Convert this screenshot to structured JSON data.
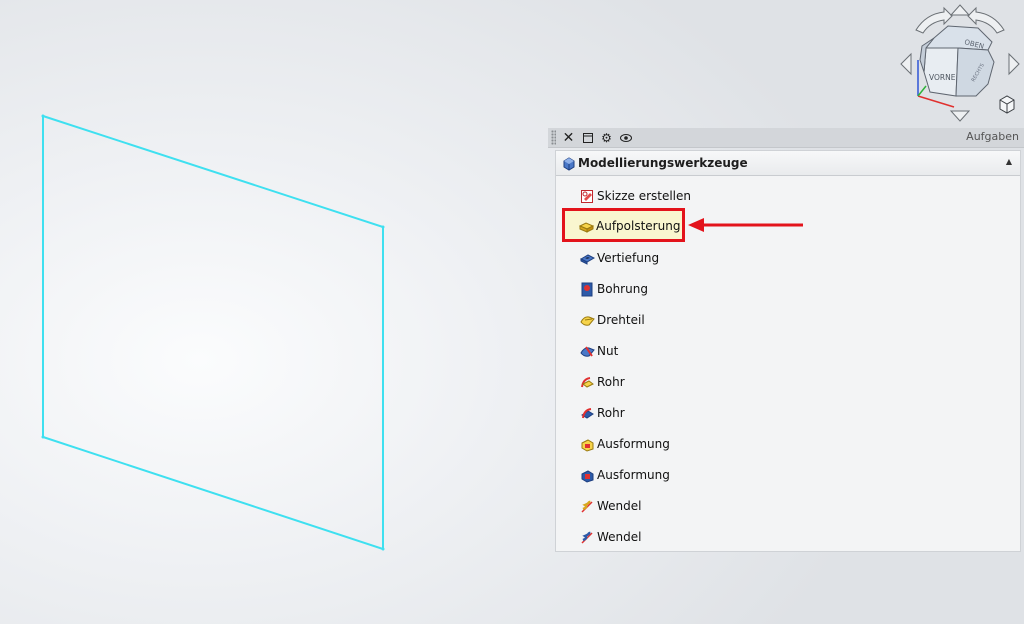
{
  "task_panel": {
    "title": "Aufgaben",
    "toolbar": {
      "close_icon": "close-icon",
      "float_icon": "dock-float-icon",
      "settings_icon": "gear-icon",
      "visibility_icon": "eye-icon"
    },
    "group": {
      "title": "Modellierungswerkzeuge",
      "icon": "part-design-icon",
      "collapse_icon": "chevron-up-icon"
    },
    "items": [
      {
        "label": "Skizze erstellen",
        "icon": "new-sketch-icon"
      },
      {
        "label": "Aufpolsterung",
        "icon": "pad-icon"
      },
      {
        "label": "Vertiefung",
        "icon": "pocket-icon"
      },
      {
        "label": "Bohrung",
        "icon": "hole-icon"
      },
      {
        "label": "Drehteil",
        "icon": "revolution-icon"
      },
      {
        "label": "Nut",
        "icon": "groove-icon"
      },
      {
        "label": "Rohr",
        "icon": "additive-pipe-icon"
      },
      {
        "label": "Rohr",
        "icon": "subtractive-pipe-icon"
      },
      {
        "label": "Ausformung",
        "icon": "additive-loft-icon"
      },
      {
        "label": "Ausformung",
        "icon": "subtractive-loft-icon"
      },
      {
        "label": "Wendel",
        "icon": "additive-helix-icon"
      },
      {
        "label": "Wendel",
        "icon": "subtractive-helix-icon"
      }
    ]
  },
  "navigation_cube": {
    "top_face": "OBEN",
    "front_face": "VORNE",
    "right_face": "RECHTS"
  },
  "annotation": {
    "highlight_color": "#e3131b",
    "highlighted_item": "Aufpolsterung"
  },
  "sketch": {
    "edge_color": "#3ee0f0"
  }
}
